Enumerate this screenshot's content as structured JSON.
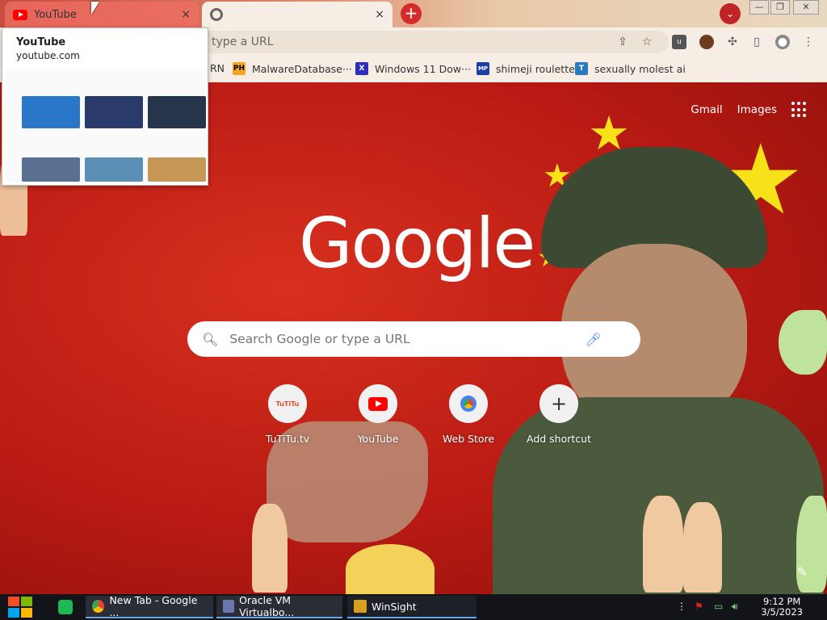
{
  "tabs": [
    {
      "label": "YouTube",
      "close": "×"
    },
    {
      "label": "",
      "close": "×"
    }
  ],
  "new_tab_symbol": "+",
  "tab_search_symbol": "⌄",
  "window_controls": {
    "minimize": "—",
    "restore": "❐",
    "close": "✕"
  },
  "omnibox": {
    "value": "Search Google or type a URL",
    "visible_text": "type a URL"
  },
  "toolbar_icons": [
    "share-icon",
    "star-icon",
    "ublock-icon",
    "profile-avatar-icon",
    "extensions-icon",
    "sidepanel-icon",
    "account-icon",
    "menu-icon"
  ],
  "bookmarks": [
    {
      "label": "RN",
      "icon": ""
    },
    {
      "label": "MalwareDatabase···",
      "icon": "PH",
      "color": "#f5a623"
    },
    {
      "label": "Windows 11 Dow···",
      "icon": "X",
      "color": "#2b2fbf"
    },
    {
      "label": "shimeji roulette",
      "icon": "MP",
      "color": "#1a3fa8"
    },
    {
      "label": "sexually molest ai",
      "icon": "T",
      "color": "#2a7ac2"
    }
  ],
  "hovercard": {
    "title": "YouTube",
    "url": "youtube.com"
  },
  "ntp": {
    "top_links": [
      "Gmail",
      "Images"
    ],
    "logo": "Google",
    "search_placeholder": "Search Google or type a URL",
    "shortcuts": [
      {
        "label": "TuTiTu.tv",
        "icon_text": "TuTiTu"
      },
      {
        "label": "YouTube",
        "icon_text": ""
      },
      {
        "label": "Web Store",
        "icon_text": ""
      },
      {
        "label": "Add shortcut",
        "icon_text": "+"
      }
    ],
    "edit_symbol": "✎"
  },
  "taskbar": {
    "tasks": [
      "New Tab - Google ...",
      "Oracle VM Virtualbo...",
      "WinSight"
    ],
    "clock_time": "9:12 PM",
    "clock_date": "3/5/2023"
  },
  "colors": {
    "accent": "#d42b2b",
    "background_red": "#c0201a",
    "taskbar": "#12141a"
  }
}
